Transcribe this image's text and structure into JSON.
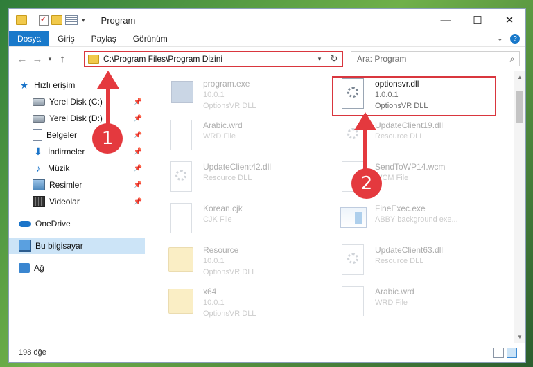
{
  "window": {
    "title": "Program"
  },
  "ribbon": {
    "tabs": [
      "Dosya",
      "Giriş",
      "Paylaş",
      "Görünüm"
    ]
  },
  "address": {
    "path": "C:\\Program Files\\Program Dizini"
  },
  "search": {
    "placeholder": "Ara: Program"
  },
  "sidebar": {
    "items": [
      {
        "label": "Hızlı erişim",
        "icon": "quick-access-icon"
      },
      {
        "label": "Yerel Disk (C:)",
        "icon": "drive-icon"
      },
      {
        "label": "Yerel Disk (D:)",
        "icon": "drive-icon"
      },
      {
        "label": "Belgeler",
        "icon": "documents-icon"
      },
      {
        "label": "İndirmeler",
        "icon": "downloads-icon"
      },
      {
        "label": "Müzik",
        "icon": "music-icon"
      },
      {
        "label": "Resimler",
        "icon": "pictures-icon"
      },
      {
        "label": "Videolar",
        "icon": "videos-icon"
      },
      {
        "label": "OneDrive",
        "icon": "onedrive-icon"
      },
      {
        "label": "Bu bilgisayar",
        "icon": "this-pc-icon"
      },
      {
        "label": "Ağ",
        "icon": "network-icon"
      }
    ]
  },
  "files": [
    {
      "name": "program.exe",
      "line2": "10.0.1",
      "line3": "OptionsVR DLL"
    },
    {
      "name": "optionsvr.dll",
      "line2": "1.0.0.1",
      "line3": "OptionsVR DLL"
    },
    {
      "name": "Arabic.wrd",
      "line2": "WRD File",
      "line3": ""
    },
    {
      "name": "UpdateClient19.dll",
      "line2": "Resource DLL",
      "line3": ""
    },
    {
      "name": "UpdateClient42.dll",
      "line2": "Resource DLL",
      "line3": ""
    },
    {
      "name": "SendToWP14.wcm",
      "line2": "WCM File",
      "line3": ""
    },
    {
      "name": "Korean.cjk",
      "line2": "CJK File",
      "line3": ""
    },
    {
      "name": "FineExec.exe",
      "line2": "ABBY background exe...",
      "line3": ""
    },
    {
      "name": "Resource",
      "line2": "10.0.1",
      "line3": "OptionsVR DLL"
    },
    {
      "name": "UpdateClient63.dll",
      "line2": "Resource DLL",
      "line3": ""
    },
    {
      "name": "x64",
      "line2": "10.0.1",
      "line3": "OptionsVR DLL"
    },
    {
      "name": "Arabic.wrd",
      "line2": "WRD File",
      "line3": ""
    }
  ],
  "status": {
    "count": "198 öğe"
  },
  "annotations": {
    "badge1": "1",
    "badge2": "2"
  },
  "colors": {
    "accent": "#1979ca",
    "highlight": "#d9363e"
  }
}
